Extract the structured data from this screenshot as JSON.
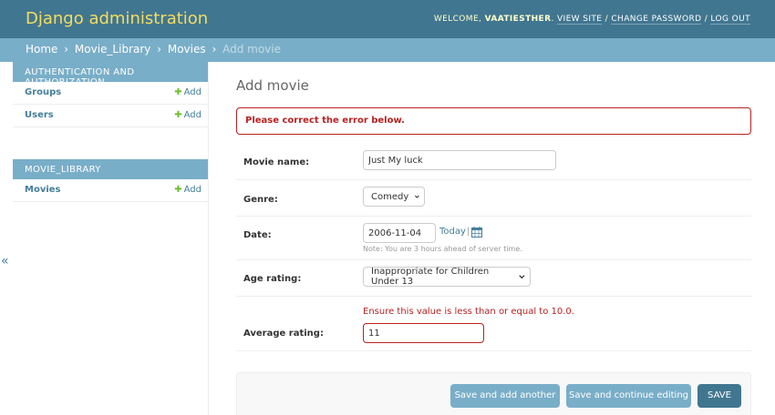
{
  "header": {
    "brand": "Django administration",
    "welcome": "WELCOME,",
    "username": "VAATIESTHER",
    "view_site": "VIEW SITE",
    "change_password": "CHANGE PASSWORD",
    "log_out": "LOG OUT",
    "sep": "/",
    "brand_color": "#f5dd5d",
    "bar_color": "#417690"
  },
  "breadcrumbs": {
    "home": "Home",
    "app": "Movie_Library",
    "model": "Movies",
    "current": "Add movie",
    "sep": "›"
  },
  "sidebar": {
    "modules": [
      {
        "caption": "AUTHENTICATION AND AUTHORIZATION",
        "items": [
          {
            "name": "Groups",
            "add": "Add"
          },
          {
            "name": "Users",
            "add": "Add"
          }
        ]
      },
      {
        "caption": "MOVIE_LIBRARY",
        "items": [
          {
            "name": "Movies",
            "add": "Add"
          }
        ]
      }
    ],
    "collapse_icon": "«"
  },
  "content": {
    "title": "Add movie",
    "error_note": "Please correct the error below.",
    "fields": {
      "movie_name": {
        "label": "Movie name:",
        "value": "Just My luck"
      },
      "genre": {
        "label": "Genre:",
        "value": "Comedy"
      },
      "date": {
        "label": "Date:",
        "value": "2006-11-04",
        "today": "Today",
        "pipe": "|",
        "help": "Note: You are 3 hours ahead of server time."
      },
      "age_rating": {
        "label": "Age rating:",
        "value": "Inappropriate for Children Under 13"
      },
      "average_rating": {
        "label": "Average rating:",
        "value": "11",
        "error": "Ensure this value is less than or equal to 10.0."
      }
    }
  },
  "submit": {
    "save_add_another": "Save and add another",
    "save_continue": "Save and continue editing",
    "save": "SAVE"
  },
  "colors": {
    "error": "#ba2121",
    "link": "#447e9b",
    "add_plus": "#70bf2b",
    "breadcrumb_bar": "#79aec8"
  }
}
